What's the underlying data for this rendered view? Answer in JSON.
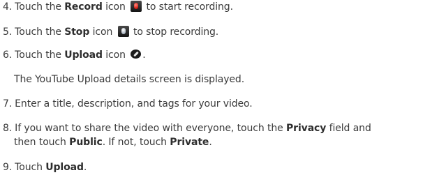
{
  "steps": [
    {
      "num": "4.",
      "pre": "Touch the ",
      "bold": "Record",
      "post": " icon",
      "tail": " to start recording.",
      "icon": "record-icon"
    },
    {
      "num": "5.",
      "pre": "Touch the ",
      "bold": "Stop",
      "post": " icon",
      "tail": " to stop recording.",
      "icon": "stop-icon"
    },
    {
      "num": "6.",
      "pre": "Touch the ",
      "bold": "Upload",
      "post": " icon",
      "tail": ".",
      "icon": "upload-icon"
    },
    {
      "note": "The YouTube Upload details screen is displayed."
    },
    {
      "num": "7.",
      "text": "Enter a title, description, and tags for your video."
    },
    {
      "num": "8.",
      "pre": "If you want to share the video with everyone, touch the ",
      "bold": "Privacy",
      "post": " field and",
      "line2_pre": "then touch ",
      "line2_bold1": "Public",
      "line2_mid": ". If not, touch ",
      "line2_bold2": "Private",
      "line2_post": "."
    },
    {
      "num": "9.",
      "pre": "Touch ",
      "bold": "Upload",
      "post": "."
    }
  ]
}
